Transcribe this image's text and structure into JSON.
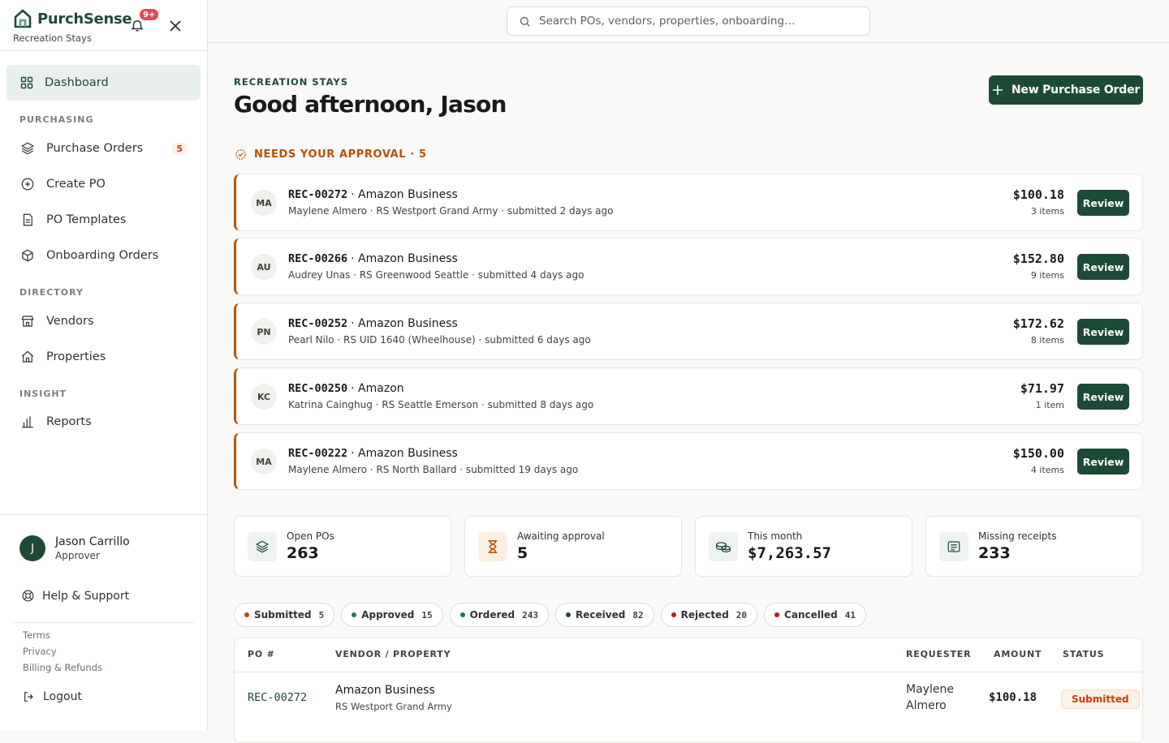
{
  "brand": {
    "name": "PurchSense",
    "org": "Recreation Stays",
    "notifications": "9+"
  },
  "search": {
    "placeholder": "Search POs, vendors, properties, onboarding…"
  },
  "nav": {
    "dashboard": "Dashboard",
    "purchasing_heading": "PURCHASING",
    "purchase_orders": "Purchase Orders",
    "purchase_orders_count": "5",
    "create_po": "Create PO",
    "po_templates": "PO Templates",
    "onboarding_orders": "Onboarding Orders",
    "directory_heading": "DIRECTORY",
    "vendors": "Vendors",
    "properties": "Properties",
    "insight_heading": "INSIGHT",
    "reports": "Reports"
  },
  "user": {
    "initial": "J",
    "name": "Jason Carrillo",
    "role": "Approver"
  },
  "footer": {
    "help": "Help & Support",
    "terms": "Terms",
    "privacy": "Privacy",
    "billing": "Billing & Refunds",
    "logout": "Logout"
  },
  "header": {
    "org_label": "RECREATION STAYS",
    "greeting": "Good afternoon, Jason",
    "new_po_label": "New Purchase Order"
  },
  "approvals": {
    "heading": "NEEDS YOUR APPROVAL · 5",
    "review_label": "Review",
    "items": [
      {
        "initials": "MA",
        "po": "REC-00272",
        "vendor": "· Amazon Business",
        "detail": "Maylene Almero · RS Westport Grand Army · submitted 2 days ago",
        "amount": "$100.18",
        "items": "3 items"
      },
      {
        "initials": "AU",
        "po": "REC-00266",
        "vendor": "· Amazon Business",
        "detail": "Audrey Unas · RS Greenwood Seattle · submitted 4 days ago",
        "amount": "$152.80",
        "items": "9 items"
      },
      {
        "initials": "PN",
        "po": "REC-00252",
        "vendor": "· Amazon Business",
        "detail": "Pearl Nilo · RS UID 1640 (Wheelhouse) · submitted 6 days ago",
        "amount": "$172.62",
        "items": "8 items"
      },
      {
        "initials": "KC",
        "po": "REC-00250",
        "vendor": "· Amazon",
        "detail": "Katrina Cainghug · RS Seattle Emerson · submitted 8 days ago",
        "amount": "$71.97",
        "items": "1 item"
      },
      {
        "initials": "MA",
        "po": "REC-00222",
        "vendor": "· Amazon Business",
        "detail": "Maylene Almero · RS North Ballard · submitted 19 days ago",
        "amount": "$150.00",
        "items": "4 items"
      }
    ]
  },
  "stats": [
    {
      "label": "Open POs",
      "value": "263",
      "icon": "layers-icon"
    },
    {
      "label": "Awaiting approval",
      "value": "5",
      "icon": "hourglass-icon"
    },
    {
      "label": "This month",
      "value": "$7,263.57",
      "icon": "coins-icon"
    },
    {
      "label": "Missing receipts",
      "value": "233",
      "icon": "receipt-icon"
    }
  ],
  "filters": [
    {
      "label": "Submitted",
      "count": "5",
      "color": "#c2410c"
    },
    {
      "label": "Approved",
      "count": "15",
      "color": "#15803d"
    },
    {
      "label": "Ordered",
      "count": "243",
      "color": "#0f766e"
    },
    {
      "label": "Received",
      "count": "82",
      "color": "#1d4a37"
    },
    {
      "label": "Rejected",
      "count": "20",
      "color": "#b91c1c"
    },
    {
      "label": "Cancelled",
      "count": "41",
      "color": "#b91c1c"
    }
  ],
  "table": {
    "headers": {
      "po": "PO #",
      "vendor": "VENDOR / PROPERTY",
      "requester": "REQUESTER",
      "amount": "AMOUNT",
      "status": "STATUS"
    },
    "rows": [
      {
        "po": "REC-00272",
        "vendor": "Amazon Business",
        "property": "RS Westport Grand Army",
        "requester_first": "Maylene",
        "requester_last": "Almero",
        "amount": "$100.18",
        "status": "Submitted"
      }
    ]
  }
}
